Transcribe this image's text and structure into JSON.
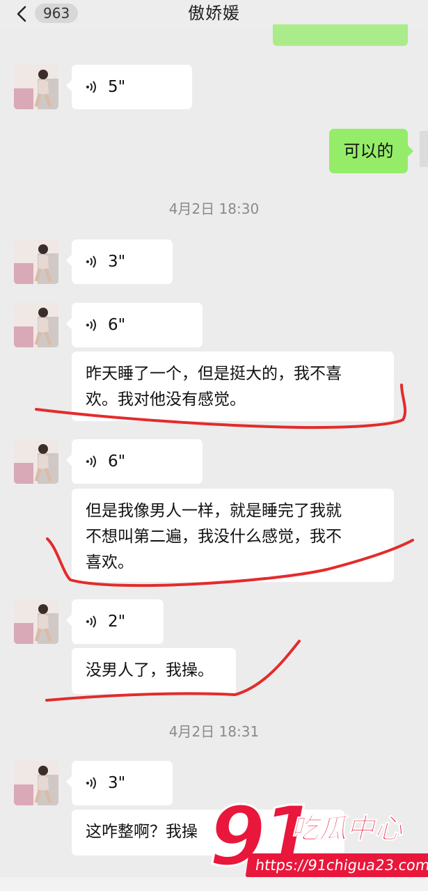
{
  "header": {
    "back_badge": "963",
    "title": "傲娇媛"
  },
  "messages": [
    {
      "type": "voice",
      "sender": "contact",
      "duration": "5\""
    },
    {
      "type": "text",
      "sender": "me",
      "text": "可以的"
    },
    {
      "type": "time",
      "text": "4月2日 18:30"
    },
    {
      "type": "voice",
      "sender": "contact",
      "duration": "3\""
    },
    {
      "type": "voice",
      "sender": "contact",
      "duration": "6\""
    },
    {
      "type": "text",
      "sender": "contact",
      "line1": "昨天睡了一个，但是挺大的，我不喜",
      "line2": "欢。我对他没有感觉。"
    },
    {
      "type": "voice",
      "sender": "contact",
      "duration": "6\""
    },
    {
      "type": "text",
      "sender": "contact",
      "line1": "但是我像男人一样，就是睡完了我就",
      "line2": "不想叫第二遍，我没什么感觉，我不",
      "line3": "喜欢。"
    },
    {
      "type": "voice",
      "sender": "contact",
      "duration": "2\""
    },
    {
      "type": "text",
      "sender": "contact",
      "text": "没男人了，我操。"
    },
    {
      "type": "time",
      "text": "4月2日 18:31"
    },
    {
      "type": "voice",
      "sender": "contact",
      "duration": "3\""
    },
    {
      "type": "text",
      "sender": "contact",
      "text": "这咋整啊？我操"
    }
  ],
  "watermark": {
    "number": "91",
    "brand": "吃瓜中心",
    "url": "https://91chigua23.com"
  },
  "colors": {
    "background": "#ececec",
    "my_bubble": "#95ec69",
    "other_bubble": "#ffffff",
    "annotation_red": "#e32b2b",
    "watermark_red": "#e8173b"
  }
}
